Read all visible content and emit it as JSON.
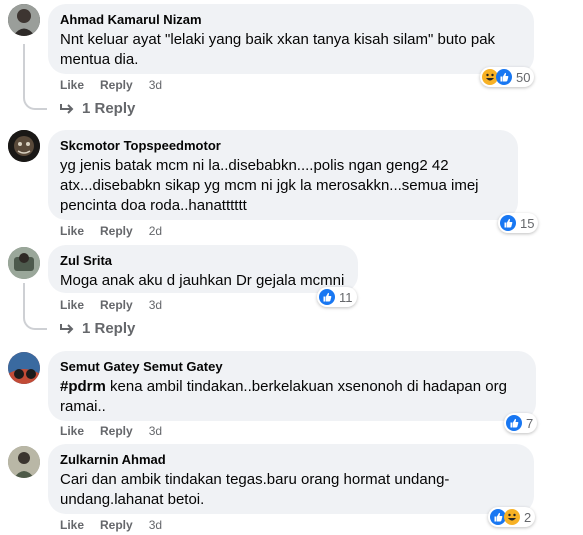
{
  "comments": [
    {
      "author": "Ahmad Kamarul Nizam",
      "text": "Nnt keluar ayat \"lelaki yang baik xkan tanya kisah silam\" buto pak mentua dia.",
      "like": "Like",
      "reply": "Reply",
      "time": "3d",
      "reaction_count": "50",
      "reactions": [
        "haha-icon",
        "like-icon"
      ],
      "replies": "1 Reply"
    },
    {
      "author": "Skcmotor Topspeedmotor",
      "text": "yg jenis batak mcm ni la..disebabkn....polis ngan geng2 42 atx...disebabkn sikap yg mcm ni jgk la merosakkn...semua imej pencinta doa roda..hanatttttt",
      "like": "Like",
      "reply": "Reply",
      "time": "2d",
      "reaction_count": "15",
      "reactions": [
        "like-icon"
      ]
    },
    {
      "author": "Zul Srita",
      "text": "Moga anak aku d jauhkan Dr gejala mcmni",
      "like": "Like",
      "reply": "Reply",
      "time": "3d",
      "reaction_count": "11",
      "reactions": [
        "like-icon"
      ],
      "replies": "1 Reply"
    },
    {
      "author": "Semut Gatey Semut Gatey",
      "hashtag": "#pdrm",
      "text": " kena ambil tindakan..berkelakuan xsenonoh di hadapan org ramai..",
      "like": "Like",
      "reply": "Reply",
      "time": "3d",
      "reaction_count": "7",
      "reactions": [
        "like-icon"
      ]
    },
    {
      "author": "Zulkarnin Ahmad",
      "text": "Cari dan ambik tindakan tegas.baru orang hormat undang-undang.lahanat betoi.",
      "like": "Like",
      "reply": "Reply",
      "time": "3d",
      "reaction_count": "2",
      "reactions": [
        "like-icon",
        "haha-icon"
      ]
    }
  ],
  "colors": {
    "bubble_bg": "#f0f2f5",
    "meta_text": "#65676b",
    "like_blue": "#1877f2",
    "haha_yellow": "#f7b125"
  }
}
